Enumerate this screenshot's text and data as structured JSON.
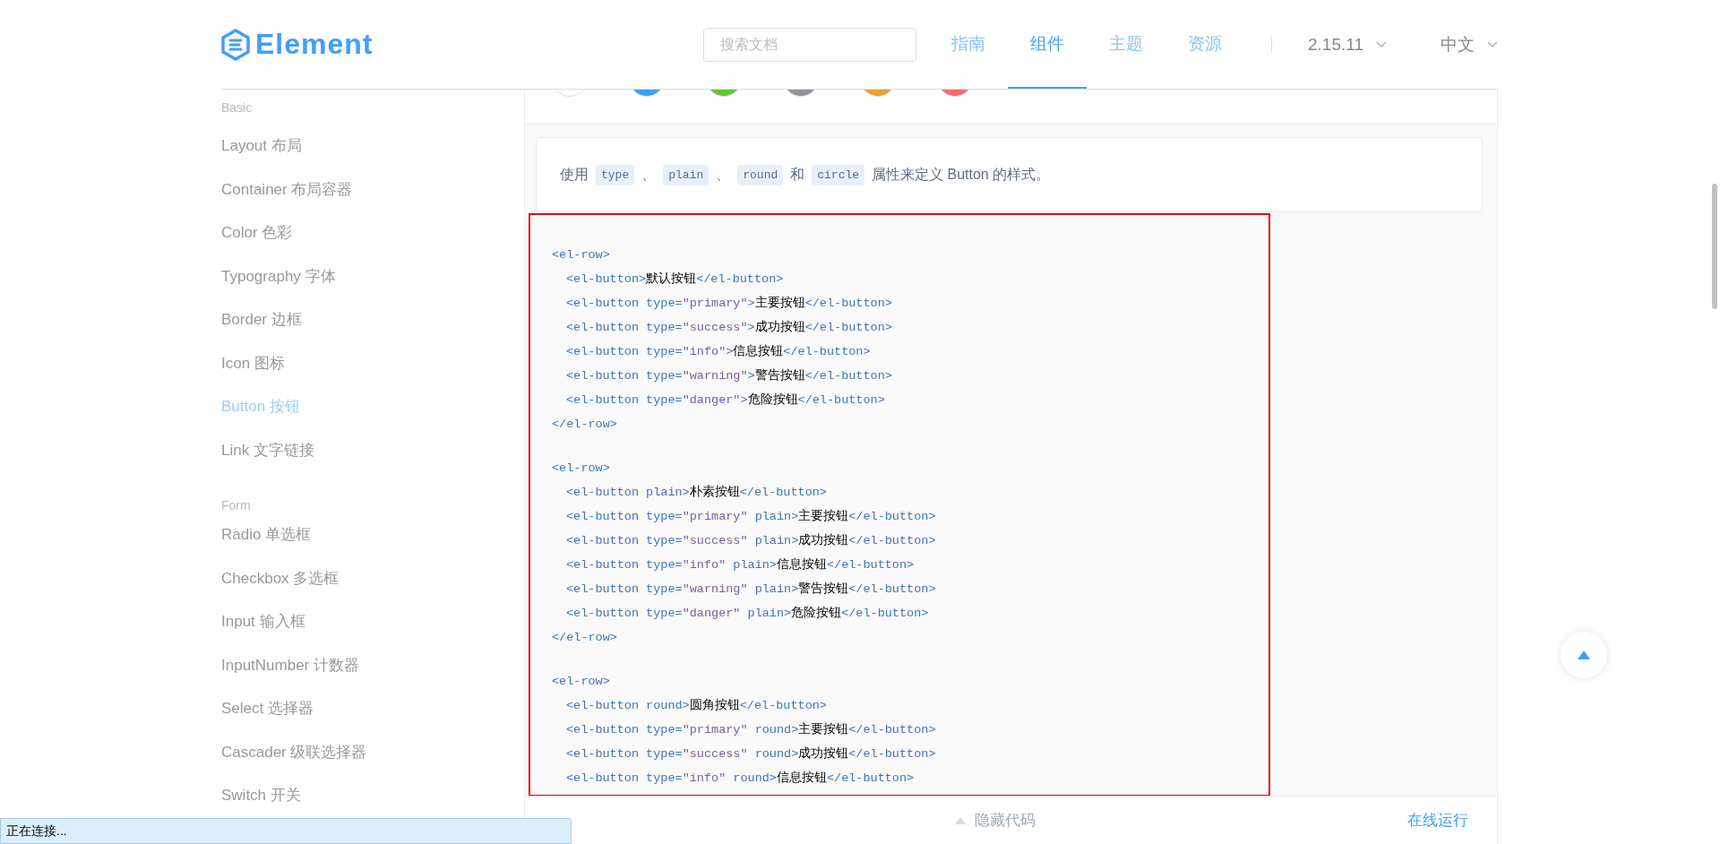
{
  "header": {
    "logo": "Element",
    "search": {
      "placeholder": "搜索文档"
    },
    "nav": [
      {
        "label": "指南",
        "selected": false
      },
      {
        "label": "组件",
        "selected": true
      },
      {
        "label": "主题",
        "selected": false
      },
      {
        "label": "资源",
        "selected": false
      }
    ],
    "version": "2.15.11",
    "language": "中文"
  },
  "sidebar": {
    "groups": [
      {
        "title": "Basic",
        "items": [
          {
            "label": "Layout 布局",
            "selected": false
          },
          {
            "label": "Container 布局容器",
            "selected": false
          },
          {
            "label": "Color 色彩",
            "selected": false
          },
          {
            "label": "Typography 字体",
            "selected": false
          },
          {
            "label": "Border 边框",
            "selected": false
          },
          {
            "label": "Icon 图标",
            "selected": false
          },
          {
            "label": "Button 按钮",
            "selected": true
          },
          {
            "label": "Link 文字链接",
            "selected": false
          }
        ]
      },
      {
        "title": "Form",
        "items": [
          {
            "label": "Radio 单选框",
            "selected": false
          },
          {
            "label": "Checkbox 多选框",
            "selected": false
          },
          {
            "label": "Input 输入框",
            "selected": false
          },
          {
            "label": "InputNumber 计数器",
            "selected": false
          },
          {
            "label": "Select 选择器",
            "selected": false
          },
          {
            "label": "Cascader 级联选择器",
            "selected": false
          },
          {
            "label": "Switch 开关",
            "selected": false
          }
        ]
      }
    ]
  },
  "demo": {
    "circle_buttons": [
      {
        "color": "#ffffff"
      },
      {
        "color": "#409eff"
      },
      {
        "color": "#67c23a"
      },
      {
        "color": "#909399"
      },
      {
        "color": "#e6a23c"
      },
      {
        "color": "#f56c6c"
      }
    ],
    "description": [
      {
        "kind": "text",
        "text": "使用"
      },
      {
        "kind": "code",
        "text": "type"
      },
      {
        "kind": "text",
        "text": "、"
      },
      {
        "kind": "code",
        "text": "plain"
      },
      {
        "kind": "text",
        "text": "、"
      },
      {
        "kind": "code",
        "text": "round"
      },
      {
        "kind": "text",
        "text": "和"
      },
      {
        "kind": "code",
        "text": "circle"
      },
      {
        "kind": "text",
        "text": "属性来定义 Button 的样式。"
      }
    ],
    "code_blocks": [
      {
        "open": "<el-row>",
        "close": "</el-row>",
        "lines": [
          [
            {
              "kind": "tag",
              "text": "<el-button>"
            },
            {
              "kind": "text",
              "text": "默认按钮"
            },
            {
              "kind": "tag",
              "text": "</el-button>"
            }
          ],
          [
            {
              "kind": "tag",
              "text": "<el-button type="
            },
            {
              "kind": "string",
              "text": "\"primary\""
            },
            {
              "kind": "tag",
              "text": ">"
            },
            {
              "kind": "text",
              "text": "主要按钮"
            },
            {
              "kind": "tag",
              "text": "</el-button>"
            }
          ],
          [
            {
              "kind": "tag",
              "text": "<el-button type="
            },
            {
              "kind": "string",
              "text": "\"success\""
            },
            {
              "kind": "tag",
              "text": ">"
            },
            {
              "kind": "text",
              "text": "成功按钮"
            },
            {
              "kind": "tag",
              "text": "</el-button>"
            }
          ],
          [
            {
              "kind": "tag",
              "text": "<el-button type="
            },
            {
              "kind": "string",
              "text": "\"info\""
            },
            {
              "kind": "tag",
              "text": ">"
            },
            {
              "kind": "text",
              "text": "信息按钮"
            },
            {
              "kind": "tag",
              "text": "</el-button>"
            }
          ],
          [
            {
              "kind": "tag",
              "text": "<el-button type="
            },
            {
              "kind": "string",
              "text": "\"warning\""
            },
            {
              "kind": "tag",
              "text": ">"
            },
            {
              "kind": "text",
              "text": "警告按钮"
            },
            {
              "kind": "tag",
              "text": "</el-button>"
            }
          ],
          [
            {
              "kind": "tag",
              "text": "<el-button type="
            },
            {
              "kind": "string",
              "text": "\"danger\""
            },
            {
              "kind": "tag",
              "text": ">"
            },
            {
              "kind": "text",
              "text": "危险按钮"
            },
            {
              "kind": "tag",
              "text": "</el-button>"
            }
          ]
        ]
      },
      {
        "open": "<el-row>",
        "close": "</el-row>",
        "lines": [
          [
            {
              "kind": "tag",
              "text": "<el-button plain>"
            },
            {
              "kind": "text",
              "text": "朴素按钮"
            },
            {
              "kind": "tag",
              "text": "</el-button>"
            }
          ],
          [
            {
              "kind": "tag",
              "text": "<el-button type="
            },
            {
              "kind": "string",
              "text": "\"primary\""
            },
            {
              "kind": "tag",
              "text": " plain>"
            },
            {
              "kind": "text",
              "text": "主要按钮"
            },
            {
              "kind": "tag",
              "text": "</el-button>"
            }
          ],
          [
            {
              "kind": "tag",
              "text": "<el-button type="
            },
            {
              "kind": "string",
              "text": "\"success\""
            },
            {
              "kind": "tag",
              "text": " plain>"
            },
            {
              "kind": "text",
              "text": "成功按钮"
            },
            {
              "kind": "tag",
              "text": "</el-button>"
            }
          ],
          [
            {
              "kind": "tag",
              "text": "<el-button type="
            },
            {
              "kind": "string",
              "text": "\"info\""
            },
            {
              "kind": "tag",
              "text": " plain>"
            },
            {
              "kind": "text",
              "text": "信息按钮"
            },
            {
              "kind": "tag",
              "text": "</el-button>"
            }
          ],
          [
            {
              "kind": "tag",
              "text": "<el-button type="
            },
            {
              "kind": "string",
              "text": "\"warning\""
            },
            {
              "kind": "tag",
              "text": " plain>"
            },
            {
              "kind": "text",
              "text": "警告按钮"
            },
            {
              "kind": "tag",
              "text": "</el-button>"
            }
          ],
          [
            {
              "kind": "tag",
              "text": "<el-button type="
            },
            {
              "kind": "string",
              "text": "\"danger\""
            },
            {
              "kind": "tag",
              "text": " plain>"
            },
            {
              "kind": "text",
              "text": "危险按钮"
            },
            {
              "kind": "tag",
              "text": "</el-button>"
            }
          ]
        ]
      },
      {
        "open": "<el-row>",
        "lines": [
          [
            {
              "kind": "tag",
              "text": "<el-button round>"
            },
            {
              "kind": "text",
              "text": "圆角按钮"
            },
            {
              "kind": "tag",
              "text": "</el-button>"
            }
          ],
          [
            {
              "kind": "tag",
              "text": "<el-button type="
            },
            {
              "kind": "string",
              "text": "\"primary\""
            },
            {
              "kind": "tag",
              "text": " round>"
            },
            {
              "kind": "text",
              "text": "主要按钮"
            },
            {
              "kind": "tag",
              "text": "</el-button>"
            }
          ],
          [
            {
              "kind": "tag",
              "text": "<el-button type="
            },
            {
              "kind": "string",
              "text": "\"success\""
            },
            {
              "kind": "tag",
              "text": " round>"
            },
            {
              "kind": "text",
              "text": "成功按钮"
            },
            {
              "kind": "tag",
              "text": "</el-button>"
            }
          ],
          [
            {
              "kind": "tag",
              "text": "<el-button type="
            },
            {
              "kind": "string",
              "text": "\"info\""
            },
            {
              "kind": "tag",
              "text": " round>"
            },
            {
              "kind": "text",
              "text": "信息按钮"
            },
            {
              "kind": "tag",
              "text": "</el-button>"
            }
          ]
        ]
      }
    ],
    "hide_code": "隐藏代码",
    "run_online": "在线运行"
  },
  "status": "正在连接..."
}
